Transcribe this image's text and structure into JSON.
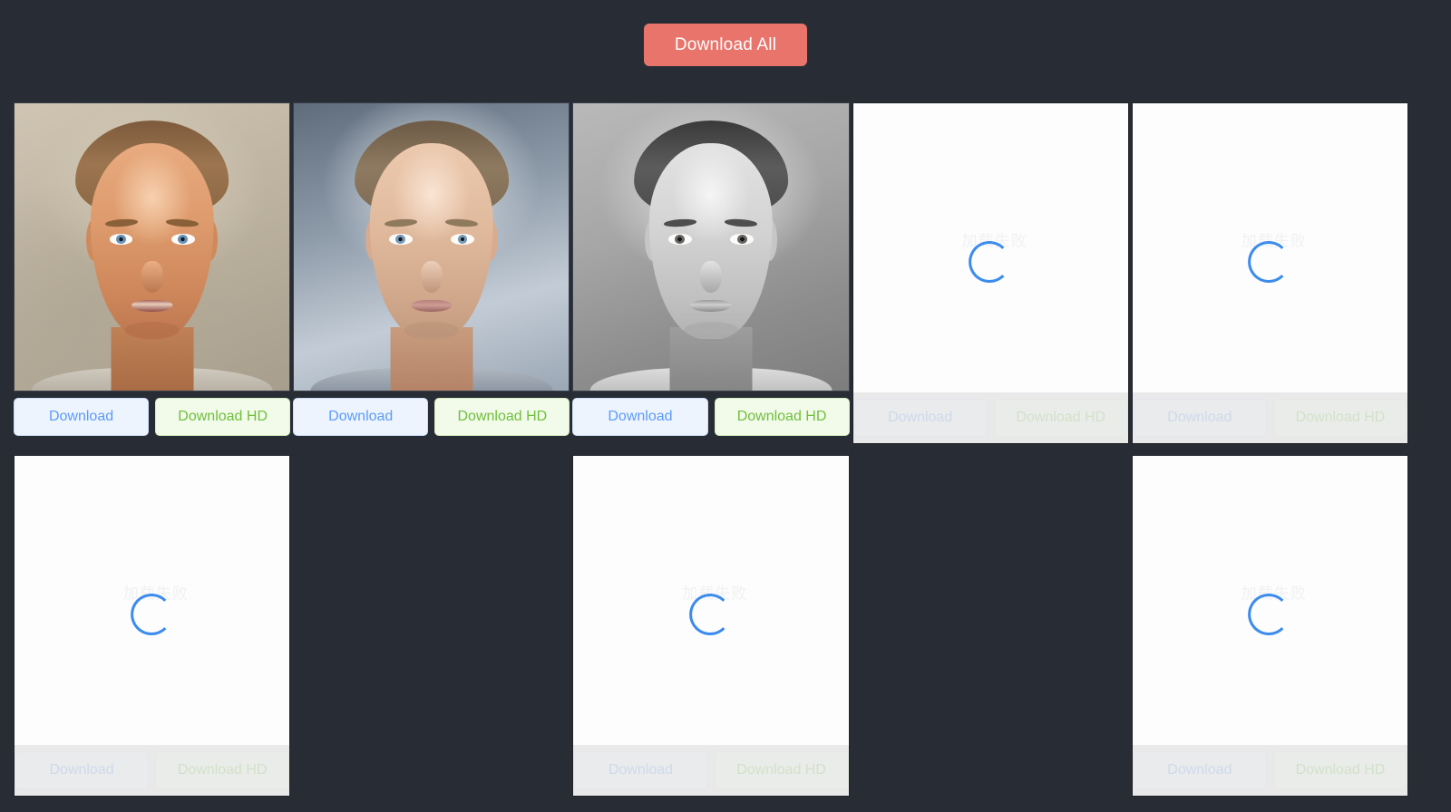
{
  "app": {
    "background_color": "#282c35",
    "card_background": "#ffffff"
  },
  "toolbar": {
    "download_all_label": "Download All",
    "download_all_color": "#e8746b"
  },
  "buttons": {
    "download_label": "Download",
    "download_hd_label": "Download HD",
    "download_color": "#5b9cf8",
    "download_hd_color": "#6fc03c"
  },
  "loading": {
    "failed_text": "加载失败",
    "spinner_color": "#3c8ced"
  },
  "grid": {
    "columns": 5,
    "rows": 2,
    "cards": [
      {
        "id": "card-1",
        "state": "loaded",
        "style": "oil-painting-warm",
        "portrait_class": "p1",
        "download_label": "Download",
        "download_hd_label": "Download HD",
        "enabled": true
      },
      {
        "id": "card-2",
        "state": "loaded",
        "style": "digital-painting-cool",
        "portrait_class": "p2",
        "download_label": "Download",
        "download_hd_label": "Download HD",
        "enabled": true
      },
      {
        "id": "card-3",
        "state": "loaded",
        "style": "pencil-sketch-grayscale",
        "portrait_class": "p3",
        "download_label": "Download",
        "download_hd_label": "Download HD",
        "enabled": true
      },
      {
        "id": "card-4",
        "state": "loading-failed",
        "failed_text": "加载失败",
        "download_label": "Download",
        "download_hd_label": "Download HD",
        "enabled": false
      },
      {
        "id": "card-5",
        "state": "loading-failed",
        "failed_text": "加载失败",
        "download_label": "Download",
        "download_hd_label": "Download HD",
        "enabled": false
      },
      {
        "id": "card-6",
        "state": "loading-failed",
        "failed_text": "加载失败",
        "download_label": "Download",
        "download_hd_label": "Download HD",
        "enabled": false
      },
      {
        "id": "card-7",
        "state": "empty",
        "enabled": false
      },
      {
        "id": "card-8",
        "state": "loading-failed",
        "failed_text": "加载失败",
        "download_label": "Download",
        "download_hd_label": "Download HD",
        "enabled": false
      },
      {
        "id": "card-9",
        "state": "empty",
        "enabled": false
      },
      {
        "id": "card-10",
        "state": "loading-failed",
        "failed_text": "加载失败",
        "download_label": "Download",
        "download_hd_label": "Download HD",
        "enabled": false
      }
    ]
  }
}
